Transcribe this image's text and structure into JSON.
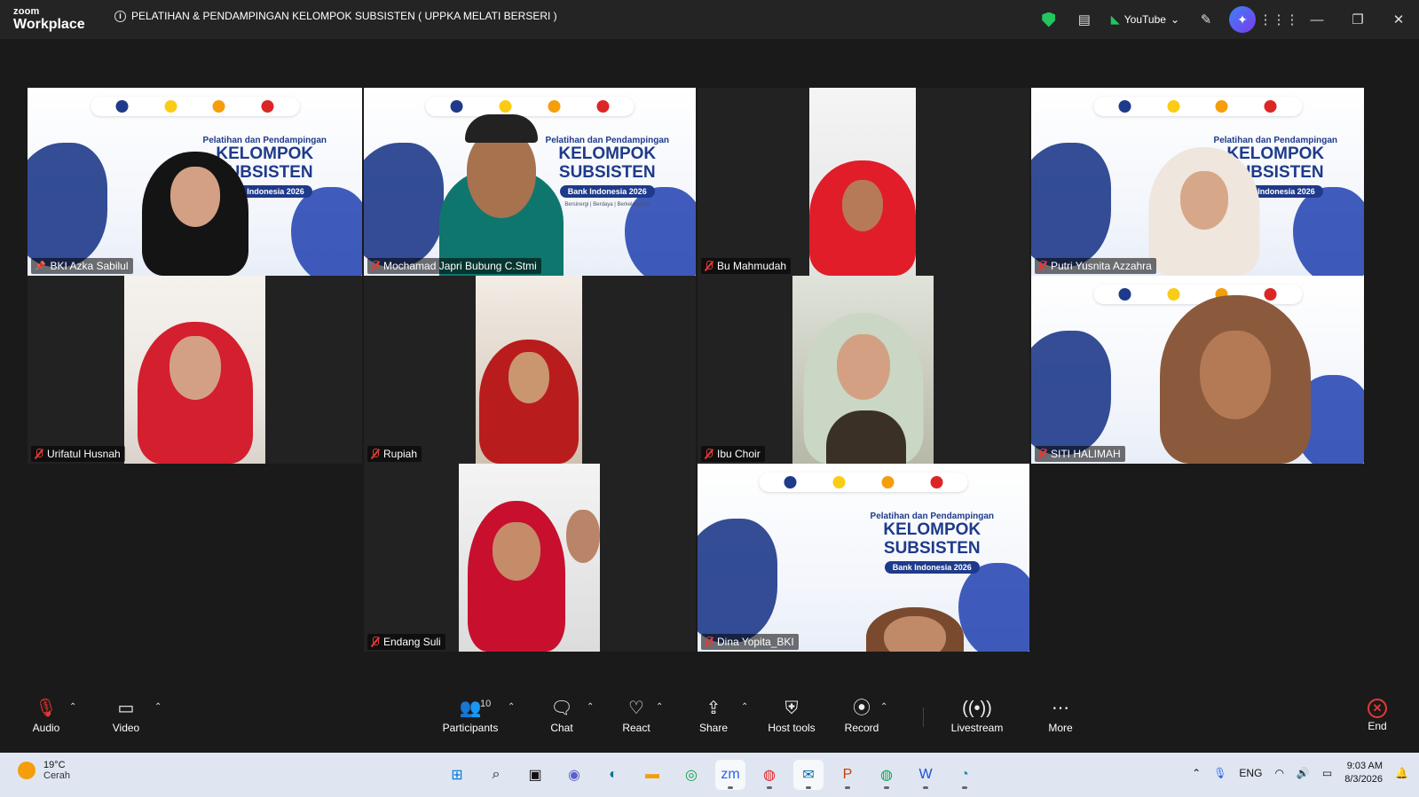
{
  "app": {
    "brand_small": "zoom",
    "brand_big": "Workplace"
  },
  "meeting": {
    "title": "PELATIHAN & PENDAMPINGAN KELOMPOK SUBSISTEN ( UPPKA MELATI BERSERI )"
  },
  "titlebar": {
    "youtube_label": "YouTube"
  },
  "banner": {
    "line1": "Pelatihan dan Pendampingan",
    "line2": "KELOMPOK",
    "line3": "SUBSISTEN",
    "pill": "Bank Indonesia 2026",
    "tagline": "Bersinergi | Berdaya | Berkelanjutan"
  },
  "participants": [
    {
      "name": "BKI Azka Sabilul",
      "pinned": true,
      "muted": false,
      "active": true
    },
    {
      "name": "Mochamad Japri Bubung C.Stmi",
      "muted": true
    },
    {
      "name": "Bu Mahmudah",
      "muted": true
    },
    {
      "name": "Putri Yusnita Azzahra",
      "muted": true
    },
    {
      "name": "Urifatul Husnah",
      "muted": true
    },
    {
      "name": "Rupiah",
      "muted": true
    },
    {
      "name": "Ibu Choir",
      "muted": true
    },
    {
      "name": "SITI HALIMAH",
      "muted": true
    },
    {
      "name": "Endang Suli",
      "muted": true
    },
    {
      "name": "Dina Yopita_BKI",
      "muted": true
    }
  ],
  "toolbar": {
    "audio": "Audio",
    "video": "Video",
    "participants": "Participants",
    "participants_count": "10",
    "chat": "Chat",
    "react": "React",
    "share": "Share",
    "host_tools": "Host tools",
    "record": "Record",
    "livestream": "Livestream",
    "more": "More",
    "end": "End"
  },
  "taskbar": {
    "weather_temp": "19°C",
    "weather_desc": "Cerah",
    "lang": "ENG",
    "time": "9:03 AM",
    "date": "8/3/2026"
  },
  "colors": {
    "active_border": "#3ddc84",
    "end_red": "#e53935",
    "muted_red": "#e53935"
  }
}
